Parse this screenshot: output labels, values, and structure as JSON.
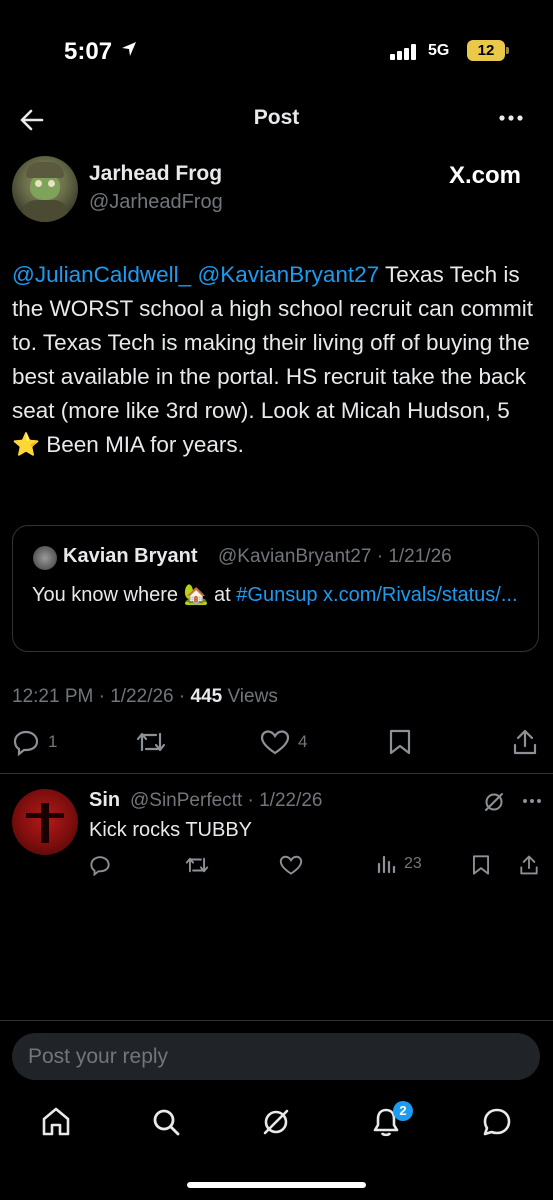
{
  "status_bar": {
    "time": "5:07",
    "network": "5G",
    "battery": "12"
  },
  "header": {
    "title": "Post"
  },
  "post": {
    "author_name": "Jarhead Frog",
    "author_handle": "@JarheadFrog",
    "source": "X.com",
    "mention1": "@JulianCaldwell_",
    "mention2": "@KavianBryant27",
    "text": "Texas Tech is the WORST school a high school recruit can commit to. Texas Tech is making their living off of buying the best available in the portal. HS recruit take the back seat (more like 3rd row). Look at Micah Hudson, 5 ⭐ Been MIA for years.",
    "quote": {
      "name": "Kavian Bryant",
      "meta": "@KavianBryant27 · 1/21/26",
      "text_before": "You know where 🏡 at ",
      "hashtag": "#Gunsup",
      "link": "x.com/Rivals/status/..."
    },
    "time": "12:21 PM · 1/22/26 · ",
    "views_count": "445",
    "views_label": " Views",
    "replies": "1",
    "likes": "4"
  },
  "reply": {
    "name": "Sin",
    "meta": "@SinPerfectt · 1/22/26",
    "text": "Kick rocks TUBBY",
    "views": "23"
  },
  "composer": {
    "placeholder": "Post your reply"
  },
  "nav": {
    "notif_count": "2"
  },
  "colors": {
    "accent": "#1d9bf0",
    "background": "#000000",
    "muted": "#71767b"
  },
  "icons": [
    "back-arrow-icon",
    "more-icon",
    "reply-icon",
    "repost-icon",
    "like-icon",
    "bookmark-icon",
    "share-icon",
    "grok-icon",
    "views-icon",
    "home-icon",
    "search-icon",
    "notifications-icon",
    "messages-icon"
  ]
}
